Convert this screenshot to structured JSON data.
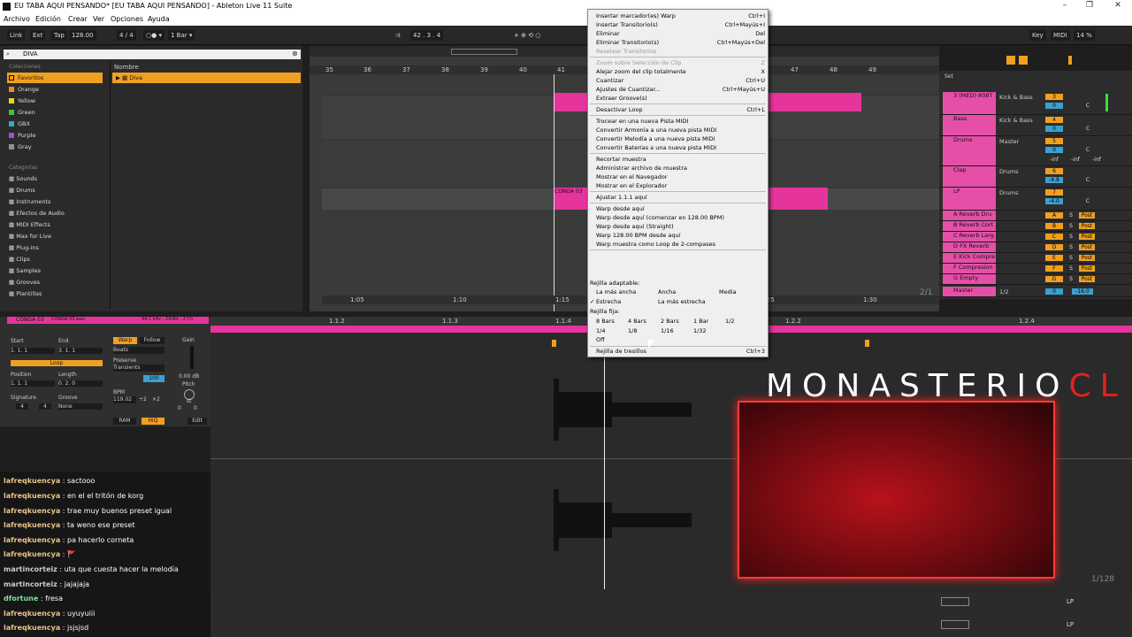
{
  "window": {
    "title": "EU TABA AQUI PENSANDO*  [EU TABA AQUI PENSANDO]  - Ableton Live 11 Suite",
    "minimize": "–",
    "maximize": "❐",
    "close": "✕"
  },
  "menubar": [
    "Archivo",
    "Edición",
    "Crear",
    "Ver",
    "Opciones",
    "Ayuda"
  ],
  "control_bar": {
    "link": "Link",
    "ext": "Ext",
    "tap": "Tap",
    "tempo": "128.00",
    "time_sig": "4 / 4",
    "metronome": "○● ▾",
    "quantize": "1 Bar ▾",
    "position": "42 .  3 .  4",
    "key": "Key",
    "midi": "MIDI",
    "cpu": "14 %"
  },
  "browser": {
    "search_value": "DIVA",
    "collections_header": "Colecciones",
    "name_header": "Nombre",
    "collections": [
      {
        "label": "Favoritos",
        "color": "#f0a020"
      },
      {
        "label": "Orange",
        "color": "#f08a20"
      },
      {
        "label": "Yellow",
        "color": "#e8d820"
      },
      {
        "label": "Green",
        "color": "#40c040"
      },
      {
        "label": "GBX",
        "color": "#30b0b0"
      },
      {
        "label": "Purple",
        "color": "#a050d0"
      },
      {
        "label": "Gray",
        "color": "#909090"
      }
    ],
    "categories_header": "Categorías",
    "categories": [
      "Sounds",
      "Drums",
      "Instruments",
      "Efectos de Audio",
      "MIDI Effects",
      "Max for Live",
      "Plug-ins",
      "Clips",
      "Samples",
      "Grooves",
      "Plantillas"
    ],
    "result": "Diva"
  },
  "arrangement": {
    "bar_numbers": [
      "35",
      "36",
      "37",
      "38",
      "39",
      "40",
      "41",
      "42",
      "43",
      "44",
      "45",
      "46",
      "47",
      "48",
      "49",
      "50"
    ],
    "time_markers": [
      "1:05",
      "1:10",
      "1:15",
      "1:25",
      "1:30"
    ],
    "clip_label": "CONGA 03",
    "scroll_counter": "2/1"
  },
  "mixer": {
    "set_label": "Set",
    "tracks": [
      {
        "name": "3 (MED) 808T",
        "route": "Kick & Bass",
        "num": "3",
        "vol": "0",
        "pan": "C"
      },
      {
        "name": "Bass",
        "route": "Kick & Bass",
        "num": "4",
        "vol": "0",
        "pan": "C"
      },
      {
        "name": "Drums",
        "route": "Master",
        "num": "5",
        "vol": "0",
        "pan": "C"
      },
      {
        "name": "Clap",
        "route": "Drums",
        "num": "6",
        "vol": "-4.8",
        "pan": "C"
      },
      {
        "name": "LP",
        "route": "Drums",
        "num": "7",
        "vol": "-4.0",
        "pan": "C"
      }
    ],
    "inf_values": [
      "-inf",
      "-inf",
      "-inf"
    ],
    "returns": [
      {
        "name": "A Reverb Dru",
        "letter": "A"
      },
      {
        "name": "B Reverb Cort",
        "letter": "B"
      },
      {
        "name": "C Reverb Larg",
        "letter": "C"
      },
      {
        "name": "D FX Reverb",
        "letter": "D"
      },
      {
        "name": "E Kick Compre",
        "letter": "E"
      },
      {
        "name": "F Compresion",
        "letter": "F"
      },
      {
        "name": "G Empty",
        "letter": "G"
      }
    ],
    "post": "Post",
    "solo": "S",
    "master": {
      "name": "Master",
      "route": "1/2",
      "vol": "0",
      "peak": "-16.0"
    }
  },
  "clip_view": {
    "clip_name": "CONGA 03",
    "file": "CONGA 03.wav",
    "info": "44.1 kHz - 24-Bit - 2 Ch",
    "start_label": "Start",
    "end_label": "End",
    "start": "1.  1.  1",
    "end": "3.  1.  1",
    "loop": "Loop",
    "position_label": "Position",
    "length_label": "Length",
    "position": "1.  1.  1",
    "length": "0.  2.  0",
    "signature_label": "Signature",
    "groove_label": "Groove",
    "sig_num": "4",
    "sig_den": "4",
    "groove": "None",
    "warp": "Warp",
    "follow": "Follow",
    "warp_mode": "Beats",
    "preserve": "Preserve",
    "transients": "Transients",
    "transient_value": "100",
    "bpm_label": "BPM",
    "bpm": "119.02",
    "half": "÷2",
    "double": "×2",
    "gain_label": "Gain",
    "gain": "0.00 dB",
    "pitch_label": "Pitch",
    "st": "st",
    "pitch": "0",
    "cents": "0",
    "ram": "RAM",
    "hiq": "HiQ",
    "edit": "Edit",
    "ruler": [
      "1.1.2",
      "1.1.3",
      "1.1.4",
      "1.2",
      "1.2.2",
      "1.2.4"
    ],
    "counter": "1/128"
  },
  "context_menu": {
    "items": [
      {
        "label": "Insertar marcador(es) Warp",
        "key": "Ctrl+I",
        "disabled": false
      },
      {
        "label": "Insertar Transitorio(s)",
        "key": "Ctrl+Mayús+I",
        "disabled": false
      },
      {
        "label": "Eliminar",
        "key": "Del",
        "disabled": false
      },
      {
        "label": "Eliminar Transitorio(s)",
        "key": "Ctrl+Mayús+Del",
        "disabled": false
      },
      {
        "label": "Resetear Transitorios",
        "key": "",
        "disabled": true
      },
      {
        "sep": true
      },
      {
        "label": "Zoom sobre Selección de Clip",
        "key": "Z",
        "disabled": true
      },
      {
        "label": "Alejar zoom del clip totalmente",
        "key": "X",
        "disabled": false
      },
      {
        "label": "Cuantizar",
        "key": "Ctrl+U",
        "disabled": false
      },
      {
        "label": "Ajustes de Cuantizar...",
        "key": "Ctrl+Mayús+U",
        "disabled": false
      },
      {
        "label": "Extraer Groove(s)",
        "key": "",
        "disabled": false
      },
      {
        "sep": true
      },
      {
        "label": "Desactivar Loop",
        "key": "Ctrl+L",
        "disabled": false
      },
      {
        "sep": true
      },
      {
        "label": "Trocear en una nueva Pista MIDI",
        "key": "",
        "disabled": false
      },
      {
        "label": "Convertir Armonía a una nueva pista MIDI",
        "key": "",
        "disabled": false
      },
      {
        "label": "Convertir Melodía a una nueva pista MIDI",
        "key": "",
        "disabled": false
      },
      {
        "label": "Convertir Baterías a una nueva pista MIDI",
        "key": "",
        "disabled": false
      },
      {
        "sep": true
      },
      {
        "label": "Recortar muestra",
        "key": "",
        "disabled": false
      },
      {
        "label": "Administrar archivo de muestra",
        "key": "",
        "disabled": false
      },
      {
        "label": "Mostrar en el Navegador",
        "key": "",
        "disabled": false
      },
      {
        "label": "Mostrar en el Explorador",
        "key": "",
        "disabled": false
      },
      {
        "sep": true
      },
      {
        "label": "Ajustar 1.1.1 aquí",
        "key": "",
        "disabled": false
      },
      {
        "sep": true
      },
      {
        "label": "Warp desde aquí",
        "key": "",
        "disabled": false
      },
      {
        "label": "Warp desde aquí (comenzar en 128.00 BPM)",
        "key": "",
        "disabled": false
      },
      {
        "label": "Warp desde aquí (Straight)",
        "key": "",
        "disabled": false
      },
      {
        "label": "Warp 128.00 BPM desde aquí",
        "key": "",
        "disabled": false
      },
      {
        "label": "Warp muestra como Loop de 2-compases",
        "key": "",
        "disabled": false
      },
      {
        "sep": true
      }
    ],
    "adaptive_header": "Rejilla adaptable:",
    "adaptive": [
      "La más ancha",
      "Ancha",
      "Media",
      "Estrecha",
      "La más estrecha"
    ],
    "fixed_header": "Rejilla fija:",
    "fixed": [
      "8 Bars",
      "4 Bars",
      "2 Bars",
      "1 Bar",
      "1/2",
      "1/4",
      "1/8",
      "1/16",
      "1/32",
      "Off"
    ],
    "triplet": {
      "label": "Rejilla de tresillos",
      "key": "Ctrl+3"
    },
    "check": "✓"
  },
  "overlay": {
    "brand_main": "MONASTERIO",
    "brand_accent": "CL"
  },
  "chat": [
    {
      "user": "lafreqkuencya",
      "msg": "sactooo"
    },
    {
      "user": "lafreqkuencya",
      "msg": "en el el tritón de korg"
    },
    {
      "user": "lafreqkuencya",
      "msg": "trae muy buenos preset igual"
    },
    {
      "user": "lafreqkuencya",
      "msg": "ta weno ese preset"
    },
    {
      "user": "lafreqkuencya",
      "msg": "pa hacerlo corneta"
    },
    {
      "user": "lafreqkuencya",
      "msg": "🚩"
    },
    {
      "user": "martincorteiz",
      "msg": "uta que cuesta hacer la melodía"
    },
    {
      "user": "martincorteiz",
      "msg": "jajajaja"
    },
    {
      "user": "dfortune",
      "msg": "fresa"
    },
    {
      "user": "lafreqkuencya",
      "msg": "uyuyuiii"
    },
    {
      "user": "lafreqkuencya",
      "msg": "jsjsjsd"
    }
  ],
  "bottom": {
    "lp1": "LP",
    "lp2": "LP"
  },
  "colors": {
    "pink": "#e5349b",
    "accent_orange": "#f0a020",
    "blue": "#3aa0d0"
  }
}
